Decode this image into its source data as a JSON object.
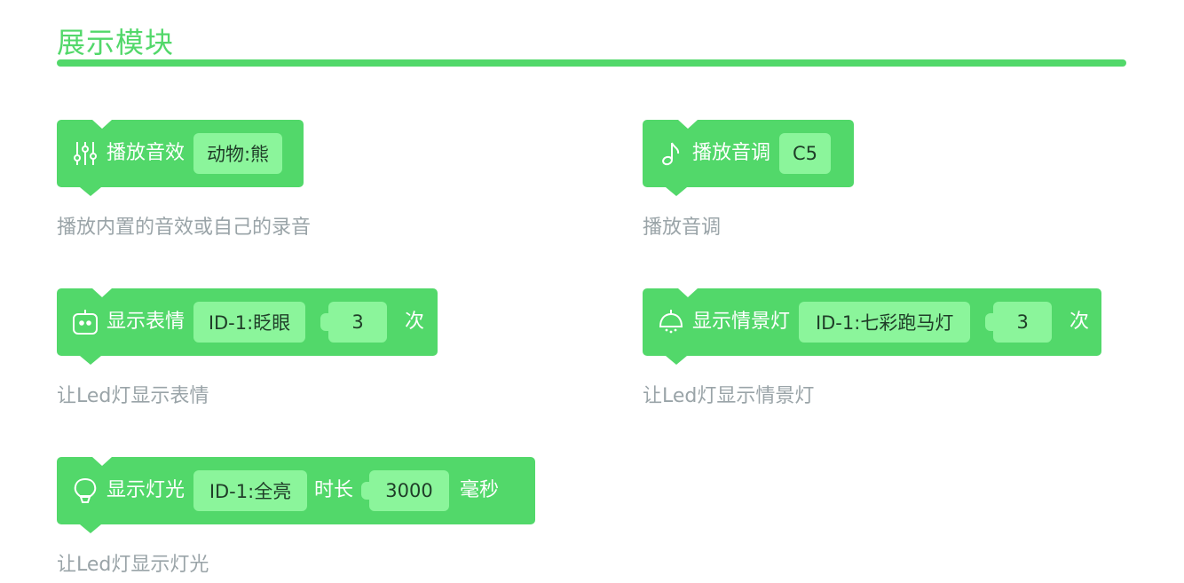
{
  "section_title": "展示模块",
  "colors": {
    "accent": "#52d86a",
    "field_bg": "#8bf59b",
    "desc_text": "#9aa4a8"
  },
  "blocks": [
    {
      "icon": "sliders-icon",
      "label": "播放音效",
      "field": "动物:熊",
      "description": "播放内置的音效或自己的录音"
    },
    {
      "icon": "music-note-icon",
      "label": "播放音调",
      "field": "C5",
      "description": "播放音调"
    },
    {
      "icon": "robot-face-icon",
      "label": "显示表情",
      "field": "ID-1:眨眼",
      "count": "3",
      "unit": "次",
      "description": "让Led灯显示表情"
    },
    {
      "icon": "ceiling-lamp-icon",
      "label": "显示情景灯",
      "field": "ID-1:七彩跑马灯",
      "count": "3",
      "unit": "次",
      "description": "让Led灯显示情景灯"
    },
    {
      "icon": "light-bulb-icon",
      "label": "显示灯光",
      "field": "ID-1:全亮",
      "duration_label": "时长",
      "duration": "3000",
      "unit": "毫秒",
      "description": "让Led灯显示灯光"
    }
  ]
}
